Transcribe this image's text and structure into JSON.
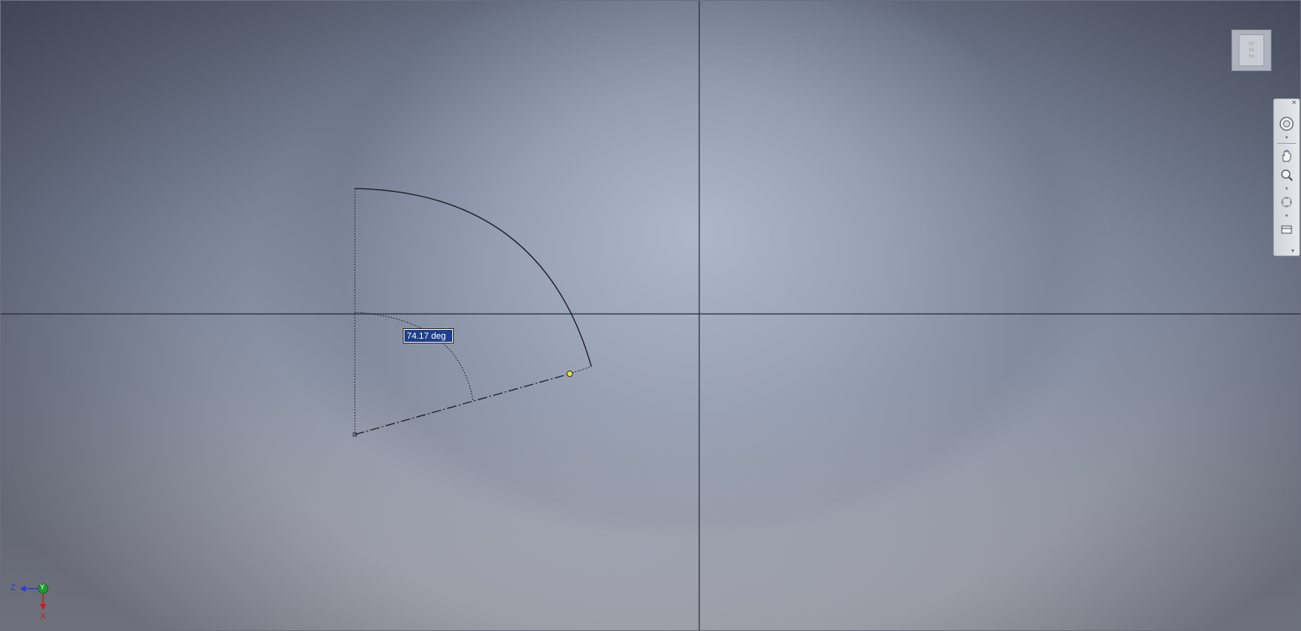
{
  "sketch": {
    "angle_dimension": "74.17 deg"
  },
  "triad": {
    "z_label": "Z",
    "y_label": "Y",
    "x_label": "X",
    "colors": {
      "z": "#2a3bd8",
      "y": "#1f9a2e",
      "x": "#c81e1e"
    }
  },
  "navigation_bar": {
    "icons": [
      "full-navigation-wheel-icon",
      "pan-icon",
      "zoom-icon",
      "orbit-icon",
      "look-at-icon"
    ]
  },
  "colors": {
    "sketch_line": "#1a1a22",
    "origin_axes": "#2b2f3a",
    "point": "#e8e04a",
    "input_background": "#1f3f8a"
  }
}
